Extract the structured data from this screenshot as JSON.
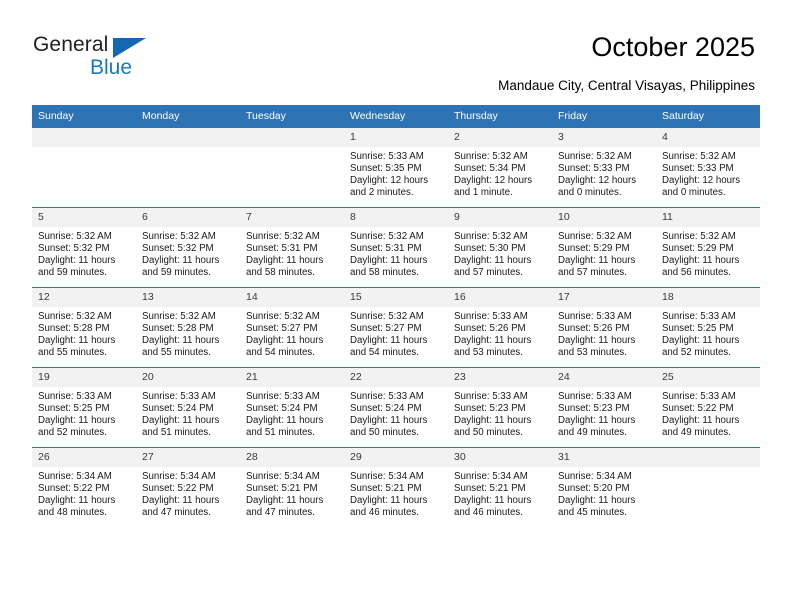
{
  "logo": {
    "word_top": "General",
    "word_bottom": "Blue",
    "triangle_color": "#1567b4",
    "text_color": "#231f20",
    "blue_text_color": "#1779c4"
  },
  "header": {
    "title": "October 2025",
    "subtitle": "Mandaue City, Central Visayas, Philippines"
  },
  "colors": {
    "header_band": "#2e74b5",
    "daynum_band": "#f2f2f2",
    "row_border": "#2e74b5",
    "text": "#1a1a1a"
  },
  "weekday_headers": [
    "Sunday",
    "Monday",
    "Tuesday",
    "Wednesday",
    "Thursday",
    "Friday",
    "Saturday"
  ],
  "weeks": [
    [
      {
        "empty": true,
        "day": ""
      },
      {
        "empty": true,
        "day": ""
      },
      {
        "empty": true,
        "day": ""
      },
      {
        "day": "1",
        "sunrise": "Sunrise: 5:33 AM",
        "sunset": "Sunset: 5:35 PM",
        "daylight": "Daylight: 12 hours and 2 minutes."
      },
      {
        "day": "2",
        "sunrise": "Sunrise: 5:32 AM",
        "sunset": "Sunset: 5:34 PM",
        "daylight": "Daylight: 12 hours and 1 minute."
      },
      {
        "day": "3",
        "sunrise": "Sunrise: 5:32 AM",
        "sunset": "Sunset: 5:33 PM",
        "daylight": "Daylight: 12 hours and 0 minutes."
      },
      {
        "day": "4",
        "sunrise": "Sunrise: 5:32 AM",
        "sunset": "Sunset: 5:33 PM",
        "daylight": "Daylight: 12 hours and 0 minutes."
      }
    ],
    [
      {
        "day": "5",
        "sunrise": "Sunrise: 5:32 AM",
        "sunset": "Sunset: 5:32 PM",
        "daylight": "Daylight: 11 hours and 59 minutes."
      },
      {
        "day": "6",
        "sunrise": "Sunrise: 5:32 AM",
        "sunset": "Sunset: 5:32 PM",
        "daylight": "Daylight: 11 hours and 59 minutes."
      },
      {
        "day": "7",
        "sunrise": "Sunrise: 5:32 AM",
        "sunset": "Sunset: 5:31 PM",
        "daylight": "Daylight: 11 hours and 58 minutes."
      },
      {
        "day": "8",
        "sunrise": "Sunrise: 5:32 AM",
        "sunset": "Sunset: 5:31 PM",
        "daylight": "Daylight: 11 hours and 58 minutes."
      },
      {
        "day": "9",
        "sunrise": "Sunrise: 5:32 AM",
        "sunset": "Sunset: 5:30 PM",
        "daylight": "Daylight: 11 hours and 57 minutes."
      },
      {
        "day": "10",
        "sunrise": "Sunrise: 5:32 AM",
        "sunset": "Sunset: 5:29 PM",
        "daylight": "Daylight: 11 hours and 57 minutes."
      },
      {
        "day": "11",
        "sunrise": "Sunrise: 5:32 AM",
        "sunset": "Sunset: 5:29 PM",
        "daylight": "Daylight: 11 hours and 56 minutes."
      }
    ],
    [
      {
        "day": "12",
        "sunrise": "Sunrise: 5:32 AM",
        "sunset": "Sunset: 5:28 PM",
        "daylight": "Daylight: 11 hours and 55 minutes."
      },
      {
        "day": "13",
        "sunrise": "Sunrise: 5:32 AM",
        "sunset": "Sunset: 5:28 PM",
        "daylight": "Daylight: 11 hours and 55 minutes."
      },
      {
        "day": "14",
        "sunrise": "Sunrise: 5:32 AM",
        "sunset": "Sunset: 5:27 PM",
        "daylight": "Daylight: 11 hours and 54 minutes."
      },
      {
        "day": "15",
        "sunrise": "Sunrise: 5:32 AM",
        "sunset": "Sunset: 5:27 PM",
        "daylight": "Daylight: 11 hours and 54 minutes."
      },
      {
        "day": "16",
        "sunrise": "Sunrise: 5:33 AM",
        "sunset": "Sunset: 5:26 PM",
        "daylight": "Daylight: 11 hours and 53 minutes."
      },
      {
        "day": "17",
        "sunrise": "Sunrise: 5:33 AM",
        "sunset": "Sunset: 5:26 PM",
        "daylight": "Daylight: 11 hours and 53 minutes."
      },
      {
        "day": "18",
        "sunrise": "Sunrise: 5:33 AM",
        "sunset": "Sunset: 5:25 PM",
        "daylight": "Daylight: 11 hours and 52 minutes."
      }
    ],
    [
      {
        "day": "19",
        "sunrise": "Sunrise: 5:33 AM",
        "sunset": "Sunset: 5:25 PM",
        "daylight": "Daylight: 11 hours and 52 minutes."
      },
      {
        "day": "20",
        "sunrise": "Sunrise: 5:33 AM",
        "sunset": "Sunset: 5:24 PM",
        "daylight": "Daylight: 11 hours and 51 minutes."
      },
      {
        "day": "21",
        "sunrise": "Sunrise: 5:33 AM",
        "sunset": "Sunset: 5:24 PM",
        "daylight": "Daylight: 11 hours and 51 minutes."
      },
      {
        "day": "22",
        "sunrise": "Sunrise: 5:33 AM",
        "sunset": "Sunset: 5:24 PM",
        "daylight": "Daylight: 11 hours and 50 minutes."
      },
      {
        "day": "23",
        "sunrise": "Sunrise: 5:33 AM",
        "sunset": "Sunset: 5:23 PM",
        "daylight": "Daylight: 11 hours and 50 minutes."
      },
      {
        "day": "24",
        "sunrise": "Sunrise: 5:33 AM",
        "sunset": "Sunset: 5:23 PM",
        "daylight": "Daylight: 11 hours and 49 minutes."
      },
      {
        "day": "25",
        "sunrise": "Sunrise: 5:33 AM",
        "sunset": "Sunset: 5:22 PM",
        "daylight": "Daylight: 11 hours and 49 minutes."
      }
    ],
    [
      {
        "day": "26",
        "sunrise": "Sunrise: 5:34 AM",
        "sunset": "Sunset: 5:22 PM",
        "daylight": "Daylight: 11 hours and 48 minutes."
      },
      {
        "day": "27",
        "sunrise": "Sunrise: 5:34 AM",
        "sunset": "Sunset: 5:22 PM",
        "daylight": "Daylight: 11 hours and 47 minutes."
      },
      {
        "day": "28",
        "sunrise": "Sunrise: 5:34 AM",
        "sunset": "Sunset: 5:21 PM",
        "daylight": "Daylight: 11 hours and 47 minutes."
      },
      {
        "day": "29",
        "sunrise": "Sunrise: 5:34 AM",
        "sunset": "Sunset: 5:21 PM",
        "daylight": "Daylight: 11 hours and 46 minutes."
      },
      {
        "day": "30",
        "sunrise": "Sunrise: 5:34 AM",
        "sunset": "Sunset: 5:21 PM",
        "daylight": "Daylight: 11 hours and 46 minutes."
      },
      {
        "day": "31",
        "sunrise": "Sunrise: 5:34 AM",
        "sunset": "Sunset: 5:20 PM",
        "daylight": "Daylight: 11 hours and 45 minutes."
      },
      {
        "empty": true,
        "day": ""
      }
    ]
  ]
}
